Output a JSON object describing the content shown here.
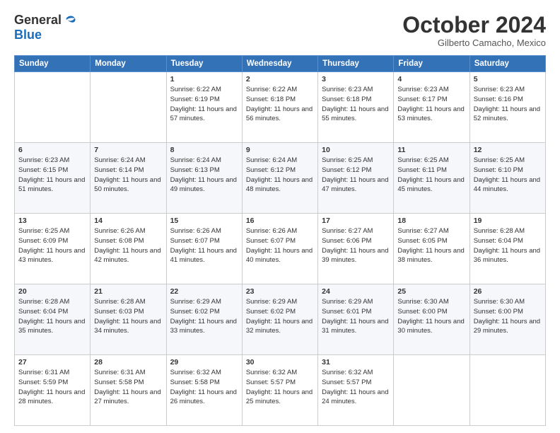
{
  "logo": {
    "general": "General",
    "blue": "Blue"
  },
  "title": "October 2024",
  "subtitle": "Gilberto Camacho, Mexico",
  "headers": [
    "Sunday",
    "Monday",
    "Tuesday",
    "Wednesday",
    "Thursday",
    "Friday",
    "Saturday"
  ],
  "weeks": [
    [
      {
        "day": "",
        "sunrise": "",
        "sunset": "",
        "daylight": ""
      },
      {
        "day": "",
        "sunrise": "",
        "sunset": "",
        "daylight": ""
      },
      {
        "day": "1",
        "sunrise": "Sunrise: 6:22 AM",
        "sunset": "Sunset: 6:19 PM",
        "daylight": "Daylight: 11 hours and 57 minutes."
      },
      {
        "day": "2",
        "sunrise": "Sunrise: 6:22 AM",
        "sunset": "Sunset: 6:18 PM",
        "daylight": "Daylight: 11 hours and 56 minutes."
      },
      {
        "day": "3",
        "sunrise": "Sunrise: 6:23 AM",
        "sunset": "Sunset: 6:18 PM",
        "daylight": "Daylight: 11 hours and 55 minutes."
      },
      {
        "day": "4",
        "sunrise": "Sunrise: 6:23 AM",
        "sunset": "Sunset: 6:17 PM",
        "daylight": "Daylight: 11 hours and 53 minutes."
      },
      {
        "day": "5",
        "sunrise": "Sunrise: 6:23 AM",
        "sunset": "Sunset: 6:16 PM",
        "daylight": "Daylight: 11 hours and 52 minutes."
      }
    ],
    [
      {
        "day": "6",
        "sunrise": "Sunrise: 6:23 AM",
        "sunset": "Sunset: 6:15 PM",
        "daylight": "Daylight: 11 hours and 51 minutes."
      },
      {
        "day": "7",
        "sunrise": "Sunrise: 6:24 AM",
        "sunset": "Sunset: 6:14 PM",
        "daylight": "Daylight: 11 hours and 50 minutes."
      },
      {
        "day": "8",
        "sunrise": "Sunrise: 6:24 AM",
        "sunset": "Sunset: 6:13 PM",
        "daylight": "Daylight: 11 hours and 49 minutes."
      },
      {
        "day": "9",
        "sunrise": "Sunrise: 6:24 AM",
        "sunset": "Sunset: 6:12 PM",
        "daylight": "Daylight: 11 hours and 48 minutes."
      },
      {
        "day": "10",
        "sunrise": "Sunrise: 6:25 AM",
        "sunset": "Sunset: 6:12 PM",
        "daylight": "Daylight: 11 hours and 47 minutes."
      },
      {
        "day": "11",
        "sunrise": "Sunrise: 6:25 AM",
        "sunset": "Sunset: 6:11 PM",
        "daylight": "Daylight: 11 hours and 45 minutes."
      },
      {
        "day": "12",
        "sunrise": "Sunrise: 6:25 AM",
        "sunset": "Sunset: 6:10 PM",
        "daylight": "Daylight: 11 hours and 44 minutes."
      }
    ],
    [
      {
        "day": "13",
        "sunrise": "Sunrise: 6:25 AM",
        "sunset": "Sunset: 6:09 PM",
        "daylight": "Daylight: 11 hours and 43 minutes."
      },
      {
        "day": "14",
        "sunrise": "Sunrise: 6:26 AM",
        "sunset": "Sunset: 6:08 PM",
        "daylight": "Daylight: 11 hours and 42 minutes."
      },
      {
        "day": "15",
        "sunrise": "Sunrise: 6:26 AM",
        "sunset": "Sunset: 6:07 PM",
        "daylight": "Daylight: 11 hours and 41 minutes."
      },
      {
        "day": "16",
        "sunrise": "Sunrise: 6:26 AM",
        "sunset": "Sunset: 6:07 PM",
        "daylight": "Daylight: 11 hours and 40 minutes."
      },
      {
        "day": "17",
        "sunrise": "Sunrise: 6:27 AM",
        "sunset": "Sunset: 6:06 PM",
        "daylight": "Daylight: 11 hours and 39 minutes."
      },
      {
        "day": "18",
        "sunrise": "Sunrise: 6:27 AM",
        "sunset": "Sunset: 6:05 PM",
        "daylight": "Daylight: 11 hours and 38 minutes."
      },
      {
        "day": "19",
        "sunrise": "Sunrise: 6:28 AM",
        "sunset": "Sunset: 6:04 PM",
        "daylight": "Daylight: 11 hours and 36 minutes."
      }
    ],
    [
      {
        "day": "20",
        "sunrise": "Sunrise: 6:28 AM",
        "sunset": "Sunset: 6:04 PM",
        "daylight": "Daylight: 11 hours and 35 minutes."
      },
      {
        "day": "21",
        "sunrise": "Sunrise: 6:28 AM",
        "sunset": "Sunset: 6:03 PM",
        "daylight": "Daylight: 11 hours and 34 minutes."
      },
      {
        "day": "22",
        "sunrise": "Sunrise: 6:29 AM",
        "sunset": "Sunset: 6:02 PM",
        "daylight": "Daylight: 11 hours and 33 minutes."
      },
      {
        "day": "23",
        "sunrise": "Sunrise: 6:29 AM",
        "sunset": "Sunset: 6:02 PM",
        "daylight": "Daylight: 11 hours and 32 minutes."
      },
      {
        "day": "24",
        "sunrise": "Sunrise: 6:29 AM",
        "sunset": "Sunset: 6:01 PM",
        "daylight": "Daylight: 11 hours and 31 minutes."
      },
      {
        "day": "25",
        "sunrise": "Sunrise: 6:30 AM",
        "sunset": "Sunset: 6:00 PM",
        "daylight": "Daylight: 11 hours and 30 minutes."
      },
      {
        "day": "26",
        "sunrise": "Sunrise: 6:30 AM",
        "sunset": "Sunset: 6:00 PM",
        "daylight": "Daylight: 11 hours and 29 minutes."
      }
    ],
    [
      {
        "day": "27",
        "sunrise": "Sunrise: 6:31 AM",
        "sunset": "Sunset: 5:59 PM",
        "daylight": "Daylight: 11 hours and 28 minutes."
      },
      {
        "day": "28",
        "sunrise": "Sunrise: 6:31 AM",
        "sunset": "Sunset: 5:58 PM",
        "daylight": "Daylight: 11 hours and 27 minutes."
      },
      {
        "day": "29",
        "sunrise": "Sunrise: 6:32 AM",
        "sunset": "Sunset: 5:58 PM",
        "daylight": "Daylight: 11 hours and 26 minutes."
      },
      {
        "day": "30",
        "sunrise": "Sunrise: 6:32 AM",
        "sunset": "Sunset: 5:57 PM",
        "daylight": "Daylight: 11 hours and 25 minutes."
      },
      {
        "day": "31",
        "sunrise": "Sunrise: 6:32 AM",
        "sunset": "Sunset: 5:57 PM",
        "daylight": "Daylight: 11 hours and 24 minutes."
      },
      {
        "day": "",
        "sunrise": "",
        "sunset": "",
        "daylight": ""
      },
      {
        "day": "",
        "sunrise": "",
        "sunset": "",
        "daylight": ""
      }
    ]
  ]
}
